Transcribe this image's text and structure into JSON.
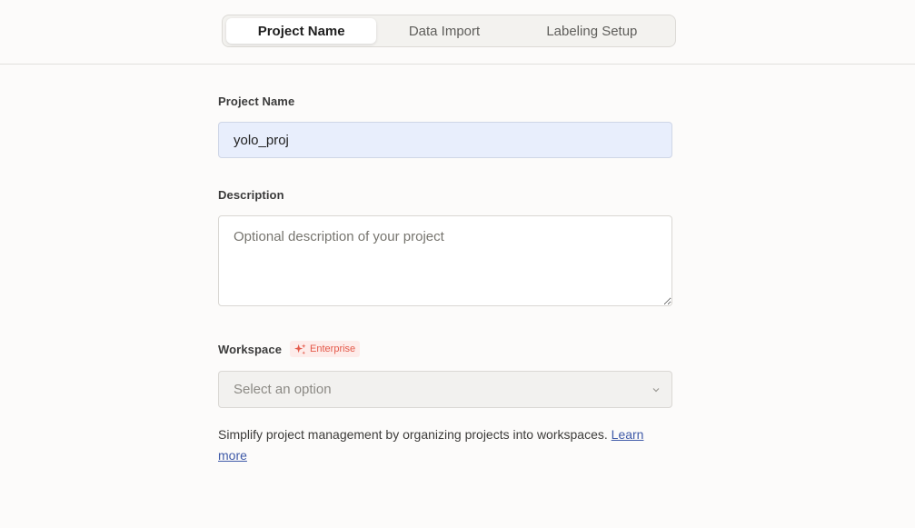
{
  "tabs": [
    {
      "label": "Project Name",
      "active": true
    },
    {
      "label": "Data Import",
      "active": false
    },
    {
      "label": "Labeling Setup",
      "active": false
    }
  ],
  "form": {
    "project_name_label": "Project Name",
    "project_name_value": "yolo_proj",
    "description_label": "Description",
    "description_placeholder": "Optional description of your project",
    "workspace_label": "Workspace",
    "enterprise_badge": "Enterprise",
    "workspace_placeholder": "Select an option",
    "help_text": "Simplify project management by organizing projects into workspaces. ",
    "learn_more": "Learn more"
  },
  "colors": {
    "accent_link": "#3f5aa8",
    "badge_text": "#e4594a",
    "badge_bg": "#fdecea",
    "input_bg": "#e8eefc"
  },
  "icons": {
    "badge_icon": "sparkle-icon",
    "select_icon": "chevron-down-icon"
  }
}
